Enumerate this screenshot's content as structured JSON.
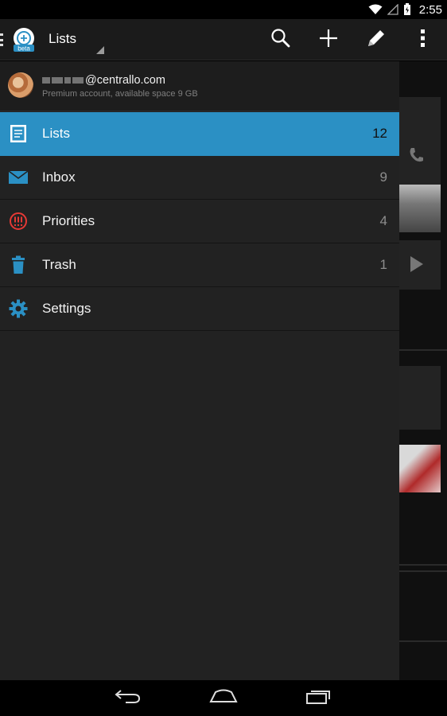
{
  "status": {
    "time": "2:55"
  },
  "actionbar": {
    "title": "Lists",
    "logo_badge": "beta"
  },
  "account": {
    "email": "@centrallo.com",
    "info": "Premium account, available space 9 GB"
  },
  "menu": [
    {
      "label": "Lists",
      "count": "12",
      "icon": "list-icon",
      "active": true
    },
    {
      "label": "Inbox",
      "count": "9",
      "icon": "envelope-icon"
    },
    {
      "label": "Priorities",
      "count": "4",
      "icon": "priority-icon"
    },
    {
      "label": "Trash",
      "count": "1",
      "icon": "trash-icon"
    },
    {
      "label": "Settings",
      "count": "",
      "icon": "gear-icon"
    }
  ],
  "colors": {
    "accent": "#2b90c4",
    "drawer_bg": "#222222",
    "priority_red": "#e53935",
    "icon_blue": "#2b90c4"
  }
}
